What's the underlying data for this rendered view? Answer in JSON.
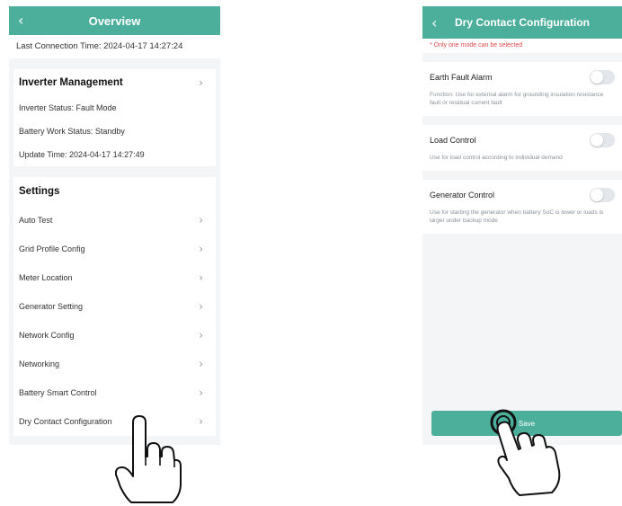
{
  "left_screen": {
    "title": "Overview",
    "back_icon": "chevron-left-icon",
    "last_connection": "Last Connection Time: 2024-04-17 14:27:24",
    "inverter_management": {
      "heading": "Inverter Management",
      "lines": [
        "Inverter Status: Fault Mode",
        "Battery Work Status: Standby",
        "Update Time: 2024-04-17 14:27:49"
      ]
    },
    "settings": {
      "heading": "Settings",
      "items": [
        "Auto Test",
        "Grid Profile Config",
        "Meter Location",
        "Generator Setting",
        "Network Config",
        "Networking",
        "Battery Smart Control",
        "Dry Contact Configuration"
      ]
    }
  },
  "right_screen": {
    "title": "Dry Contact Configuration",
    "warning": "* Only one mode can be selected",
    "modes": [
      {
        "name": "Earth Fault Alarm",
        "enabled": false,
        "description": "Function: Use for external alarm for grounding insulation resistance fault or residual current fault"
      },
      {
        "name": "Load Control",
        "enabled": false,
        "description": "Use for load control according to individual demand"
      },
      {
        "name": "Generator Control",
        "enabled": false,
        "description": "Use for starting the generator when battery SoC is lower or loads is larger under backup mode"
      }
    ],
    "save_label": "Save"
  },
  "colors": {
    "accent": "#4caf9b",
    "background": "#f3f5f7",
    "warning": "#e54848"
  }
}
